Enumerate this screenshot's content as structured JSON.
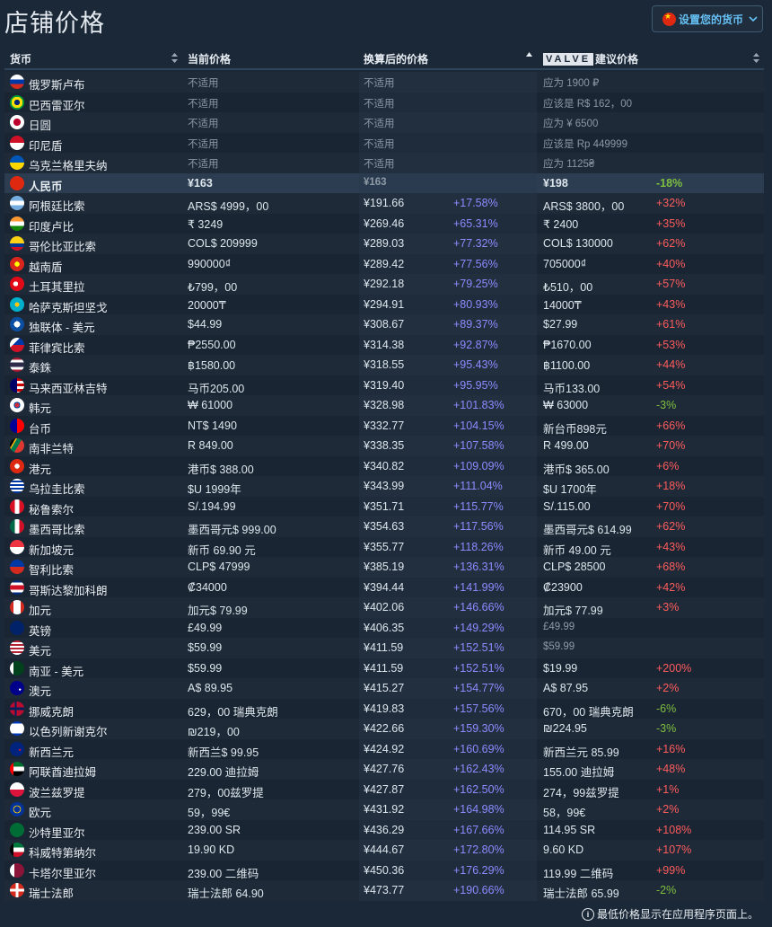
{
  "page": {
    "title": "店铺价格"
  },
  "currency_button": {
    "label": "设置您的货币"
  },
  "columns": {
    "currency": "货币",
    "current_price": "当前价格",
    "converted_price": "换算后的价格",
    "valve_logo": "VALVE",
    "valve_suggested": "建议价格"
  },
  "footnote": "最低价格显示在应用程序页面上。",
  "rows": [
    {
      "name": "俄罗斯卢布",
      "flag": "ru",
      "current": "不适用",
      "conv": "不适用",
      "diff": "",
      "sug": "应为 1900 ₽",
      "sugd": "",
      "na": true
    },
    {
      "name": "巴西雷亚尔",
      "flag": "br",
      "current": "不适用",
      "conv": "不适用",
      "diff": "",
      "sug": "应该是 R$ 162，00",
      "sugd": "",
      "na": true
    },
    {
      "name": "日圆",
      "flag": "jp",
      "current": "不适用",
      "conv": "不适用",
      "diff": "",
      "sug": "应为 ¥ 6500",
      "sugd": "",
      "na": true
    },
    {
      "name": "印尼盾",
      "flag": "id",
      "current": "不适用",
      "conv": "不适用",
      "diff": "",
      "sug": "应该是 Rp 449999",
      "sugd": "",
      "na": true
    },
    {
      "name": "乌克兰格里夫纳",
      "flag": "ua",
      "current": "不适用",
      "conv": "不适用",
      "diff": "",
      "sug": "应为 1125₴",
      "sugd": "",
      "na": true
    },
    {
      "name": "人民币",
      "flag": "cn",
      "current": "¥163",
      "conv": "¥163",
      "diff": "",
      "sug": "¥198",
      "sugd": "-18%",
      "hl": true
    },
    {
      "name": "阿根廷比索",
      "flag": "ar",
      "current": "ARS$ 4999，00",
      "conv": "¥191.66",
      "diff": "+17.58%",
      "sug": "ARS$ 3800，00",
      "sugd": "+32%"
    },
    {
      "name": "印度卢比",
      "flag": "in",
      "current": "₹ 3249",
      "conv": "¥269.46",
      "diff": "+65.31%",
      "sug": "₹ 2400",
      "sugd": "+35%"
    },
    {
      "name": "哥伦比亚比索",
      "flag": "co",
      "current": "COL$ 209999",
      "conv": "¥289.03",
      "diff": "+77.32%",
      "sug": "COL$ 130000",
      "sugd": "+62%"
    },
    {
      "name": "越南盾",
      "flag": "vn",
      "current": "990000₫",
      "conv": "¥289.42",
      "diff": "+77.56%",
      "sug": "705000₫",
      "sugd": "+40%"
    },
    {
      "name": "土耳其里拉",
      "flag": "tr",
      "current": "₺799，00",
      "conv": "¥292.18",
      "diff": "+79.25%",
      "sug": "₺510，00",
      "sugd": "+57%"
    },
    {
      "name": "哈萨克斯坦坚戈",
      "flag": "kz",
      "current": "20000₸",
      "conv": "¥294.91",
      "diff": "+80.93%",
      "sug": "14000₸",
      "sugd": "+43%"
    },
    {
      "name": "独联体 - 美元",
      "flag": "cis",
      "current": "$44.99",
      "conv": "¥308.67",
      "diff": "+89.37%",
      "sug": "$27.99",
      "sugd": "+61%"
    },
    {
      "name": "菲律宾比索",
      "flag": "ph",
      "current": "₱2550.00",
      "conv": "¥314.38",
      "diff": "+92.87%",
      "sug": "₱1670.00",
      "sugd": "+53%"
    },
    {
      "name": "泰銖",
      "flag": "th",
      "current": "฿1580.00",
      "conv": "¥318.55",
      "diff": "+95.43%",
      "sug": "฿1100.00",
      "sugd": "+44%"
    },
    {
      "name": "马来西亚林吉特",
      "flag": "my",
      "current": "马币205.00",
      "conv": "¥319.40",
      "diff": "+95.95%",
      "sug": "马币133.00",
      "sugd": "+54%"
    },
    {
      "name": "韩元",
      "flag": "kr",
      "current": "₩ 61000",
      "conv": "¥328.98",
      "diff": "+101.83%",
      "sug": "₩ 63000",
      "sugd": "-3%"
    },
    {
      "name": "台币",
      "flag": "tw",
      "current": "NT$ 1490",
      "conv": "¥332.77",
      "diff": "+104.15%",
      "sug": "新台币898元",
      "sugd": "+66%"
    },
    {
      "name": "南非兰特",
      "flag": "za",
      "current": "R 849.00",
      "conv": "¥338.35",
      "diff": "+107.58%",
      "sug": "R 499.00",
      "sugd": "+70%"
    },
    {
      "name": "港元",
      "flag": "hk",
      "current": "港币$ 388.00",
      "conv": "¥340.82",
      "diff": "+109.09%",
      "sug": "港币$ 365.00",
      "sugd": "+6%"
    },
    {
      "name": "乌拉圭比索",
      "flag": "uy",
      "current": "$U 1999年",
      "conv": "¥343.99",
      "diff": "+111.04%",
      "sug": "$U 1700年",
      "sugd": "+18%"
    },
    {
      "name": "秘鲁索尔",
      "flag": "pe",
      "current": "S/.194.99",
      "conv": "¥351.71",
      "diff": "+115.77%",
      "sug": "S/.115.00",
      "sugd": "+70%"
    },
    {
      "name": "墨西哥比索",
      "flag": "mx",
      "current": "墨西哥元$ 999.00",
      "conv": "¥354.63",
      "diff": "+117.56%",
      "sug": "墨西哥元$ 614.99",
      "sugd": "+62%"
    },
    {
      "name": "新加坡元",
      "flag": "sg",
      "current": "新币 69.90 元",
      "conv": "¥355.77",
      "diff": "+118.26%",
      "sug": "新币 49.00 元",
      "sugd": "+43%"
    },
    {
      "name": "智利比索",
      "flag": "cl",
      "current": "CLP$ 47999",
      "conv": "¥385.19",
      "diff": "+136.31%",
      "sug": "CLP$ 28500",
      "sugd": "+68%"
    },
    {
      "name": "哥斯达黎加科朗",
      "flag": "cr",
      "current": "₡34000",
      "conv": "¥394.44",
      "diff": "+141.99%",
      "sug": "₡23900",
      "sugd": "+42%"
    },
    {
      "name": "加元",
      "flag": "ca",
      "current": "加元$ 79.99",
      "conv": "¥402.06",
      "diff": "+146.66%",
      "sug": "加元$ 77.99",
      "sugd": "+3%"
    },
    {
      "name": "英镑",
      "flag": "gb",
      "current": "£49.99",
      "conv": "¥406.35",
      "diff": "+149.29%",
      "sug": "£49.99",
      "sugd": "",
      "sugdim": true
    },
    {
      "name": "美元",
      "flag": "us",
      "current": "$59.99",
      "conv": "¥411.59",
      "diff": "+152.51%",
      "sug": "$59.99",
      "sugd": "",
      "sugdim": true
    },
    {
      "name": "南亚 - 美元",
      "flag": "pk",
      "current": "$59.99",
      "conv": "¥411.59",
      "diff": "+152.51%",
      "sug": "$19.99",
      "sugd": "+200%"
    },
    {
      "name": "澳元",
      "flag": "au",
      "current": "A$ 89.95",
      "conv": "¥415.27",
      "diff": "+154.77%",
      "sug": "A$ 87.95",
      "sugd": "+2%"
    },
    {
      "name": "挪威克朗",
      "flag": "no",
      "current": "629，00 瑞典克朗",
      "conv": "¥419.83",
      "diff": "+157.56%",
      "sug": "670，00 瑞典克朗",
      "sugd": "-6%"
    },
    {
      "name": "以色列新谢克尔",
      "flag": "il",
      "current": "₪219，00",
      "conv": "¥422.66",
      "diff": "+159.30%",
      "sug": "₪224.95",
      "sugd": "-3%"
    },
    {
      "name": "新西兰元",
      "flag": "nz",
      "current": "新西兰$ 99.95",
      "conv": "¥424.92",
      "diff": "+160.69%",
      "sug": "新西兰元 85.99",
      "sugd": "+16%"
    },
    {
      "name": "阿联酋迪拉姆",
      "flag": "ae",
      "current": "229.00 迪拉姆",
      "conv": "¥427.76",
      "diff": "+162.43%",
      "sug": "155.00 迪拉姆",
      "sugd": "+48%"
    },
    {
      "name": "波兰兹罗提",
      "flag": "pl",
      "current": "279，00兹罗提",
      "conv": "¥427.87",
      "diff": "+162.50%",
      "sug": "274，99兹罗提",
      "sugd": "+1%"
    },
    {
      "name": "欧元",
      "flag": "eu",
      "current": "59，99€",
      "conv": "¥431.92",
      "diff": "+164.98%",
      "sug": "58，99€",
      "sugd": "+2%"
    },
    {
      "name": "沙特里亚尔",
      "flag": "sa",
      "current": "239.00 SR",
      "conv": "¥436.29",
      "diff": "+167.66%",
      "sug": "114.95 SR",
      "sugd": "+108%"
    },
    {
      "name": "科威特第纳尔",
      "flag": "kw",
      "current": "19.90 KD",
      "conv": "¥444.67",
      "diff": "+172.80%",
      "sug": "9.60 KD",
      "sugd": "+107%"
    },
    {
      "name": "卡塔尔里亚尔",
      "flag": "qa",
      "current": "239.00 二维码",
      "conv": "¥450.36",
      "diff": "+176.29%",
      "sug": "119.99 二维码",
      "sugd": "+99%"
    },
    {
      "name": "瑞士法郎",
      "flag": "ch",
      "current": "瑞士法郎 64.90",
      "conv": "¥473.77",
      "diff": "+190.66%",
      "sug": "瑞士法郎 65.99",
      "sugd": "-2%"
    }
  ]
}
